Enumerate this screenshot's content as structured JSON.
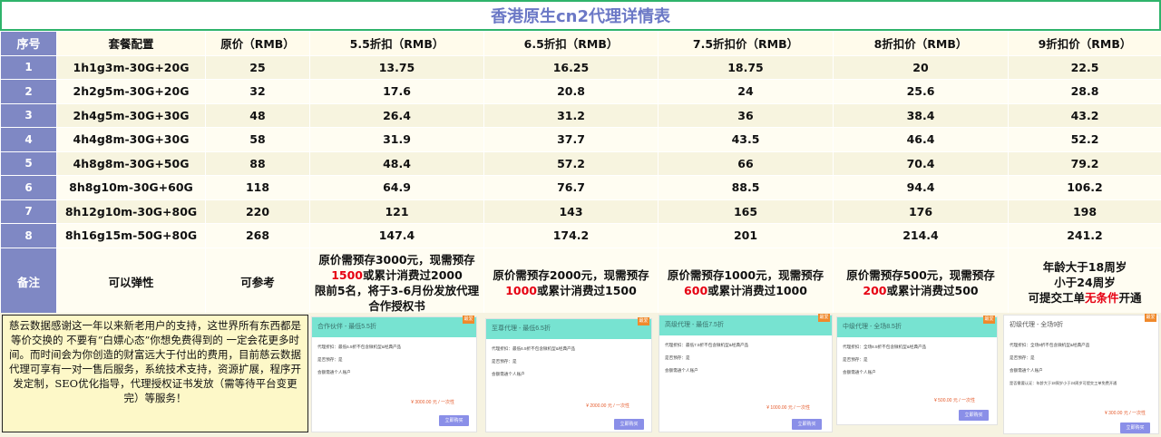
{
  "title": "香港原生cn2代理详情表",
  "headers": [
    "序号",
    "套餐配置",
    "原价（RMB）",
    "5.5折扣（RMB）",
    "6.5折扣（RMB）",
    "7.5折扣价（RMB）",
    "8折扣价（RMB）",
    "9折扣价（RMB）"
  ],
  "rows": [
    {
      "no": "1",
      "config": "1h1g3m-30G+20G",
      "orig": "25",
      "p55": "13.75",
      "p65": "16.25",
      "p75": "18.75",
      "p80": "20",
      "p90": "22.5"
    },
    {
      "no": "2",
      "config": "2h2g5m-30G+20G",
      "orig": "32",
      "p55": "17.6",
      "p65": "20.8",
      "p75": "24",
      "p80": "25.6",
      "p90": "28.8"
    },
    {
      "no": "3",
      "config": "2h4g5m-30G+30G",
      "orig": "48",
      "p55": "26.4",
      "p65": "31.2",
      "p75": "36",
      "p80": "38.4",
      "p90": "43.2"
    },
    {
      "no": "4",
      "config": "4h4g8m-30G+30G",
      "orig": "58",
      "p55": "31.9",
      "p65": "37.7",
      "p75": "43.5",
      "p80": "46.4",
      "p90": "52.2"
    },
    {
      "no": "5",
      "config": "4h8g8m-30G+50G",
      "orig": "88",
      "p55": "48.4",
      "p65": "57.2",
      "p75": "66",
      "p80": "70.4",
      "p90": "79.2"
    },
    {
      "no": "6",
      "config": "8h8g10m-30G+60G",
      "orig": "118",
      "p55": "64.9",
      "p65": "76.7",
      "p75": "88.5",
      "p80": "94.4",
      "p90": "106.2"
    },
    {
      "no": "7",
      "config": "8h12g10m-30G+80G",
      "orig": "220",
      "p55": "121",
      "p65": "143",
      "p75": "165",
      "p80": "176",
      "p90": "198"
    },
    {
      "no": "8",
      "config": "8h16g15m-50G+80G",
      "orig": "268",
      "p55": "147.4",
      "p65": "174.2",
      "p75": "201",
      "p80": "214.4",
      "p90": "241.2"
    }
  ],
  "notes": {
    "label": "备注",
    "config": "可以弹性",
    "orig": "可参考",
    "p55_a": "原价需预存3000元，现需预存",
    "p55_red": "1500",
    "p55_b": "或累计消费过2000",
    "p55_c": "限前5名，将于3-6月份发放代理合作授权书",
    "p65_a": "原价需预存2000元，现需预存",
    "p65_red": "1000",
    "p65_b": "或累计消费过1500",
    "p75_a": "原价需预存1000元，现需预存",
    "p75_red": "600",
    "p75_b": "或累计消费过1000",
    "p80_a": "原价需预存500元，现需预存",
    "p80_red": "200",
    "p80_b": "或累计消费过500",
    "p90_a": "年龄大于18周岁",
    "p90_b": "小于24周岁",
    "p90_c": "可提交工单",
    "p90_red": "无条件",
    "p90_d": "开通"
  },
  "thanks": "慈云数据感谢这一年以来新老用户的支持，这世界所有东西都是等价交换的 不要有“白嫖心态”你想免费得到的 一定会花更多时间。而时间会为你创造的财富远大于付出的费用，目前慈云数据代理可享有一对一售后服务，系统技术支持，资源扩展，程序开发定制，SEO优化指导，代理授权证书发放（需等待平台变更完）等服务！",
  "cards": [
    {
      "title": "合作伙伴 - 最低5.5折",
      "badge": "最爱",
      "line1": "代理折扣：最低5.5折不包含微机型&经典产品",
      "line2": "是否预存：是",
      "line3": "会额需通个人账户",
      "price": "¥ 3000.00 元 / 一次性",
      "button": "立即购买"
    },
    {
      "title": "至尊代理 - 最低6.5折",
      "badge": "最爱",
      "line1": "代理折扣：最低6.5折不包含微机型&经典产品",
      "line2": "是否预存：是",
      "line3": "会额需通个人账户",
      "price": "¥ 2000.00 元 / 一次性",
      "button": "立即购买"
    },
    {
      "title": "高级代理 - 最低7.5折",
      "badge": "最爱",
      "line1": "代理折扣：最低7.5折不包含微机型&经典产品",
      "line2": "是否预存：是",
      "line3": "会额需通个人账户",
      "price": "¥ 1000.00 元 / 一次性",
      "button": "立即购买"
    },
    {
      "title": "中级代理 - 全场8.5折",
      "badge": "最爱",
      "line1": "代理折扣：全场8.5折不包含微机型&经典产品",
      "line2": "是否预存：是",
      "line3": "会额需通个人账户",
      "price": "¥ 500.00 元 / 一次性",
      "button": "立即购买"
    },
    {
      "title": "初级代理 - 全场9折",
      "badge": "最爱",
      "line1": "代理折扣：全场9折不包含微机型&经典产品",
      "line2": "是否预存：是",
      "line3": "会额需通个人账户",
      "line4": "是否需要认证：年龄大于18周岁小于24周岁可提交工单免费开通",
      "price": "¥ 300.00 元 / 一次性",
      "button": "立即购买"
    }
  ]
}
